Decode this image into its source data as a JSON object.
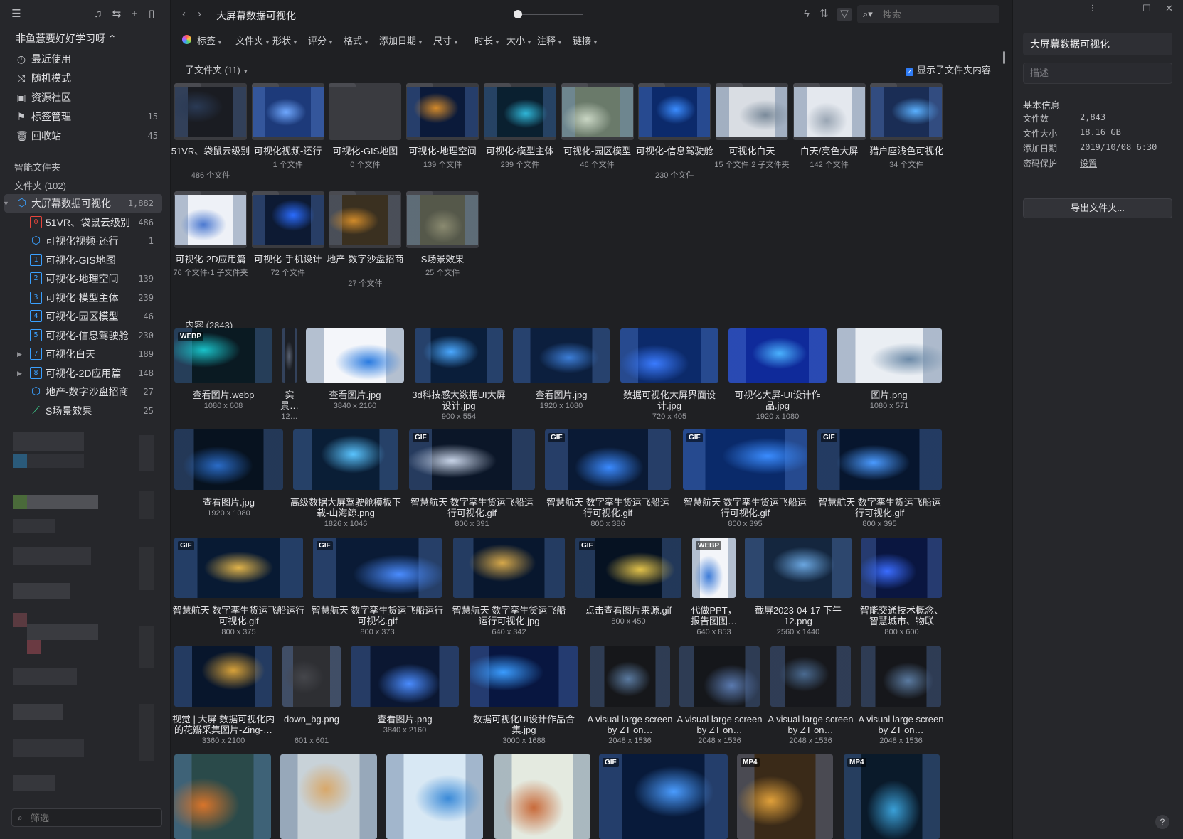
{
  "library": {
    "name": "非鱼薏要好好学习呀 ⌃"
  },
  "nav": [
    {
      "label": "最近使用",
      "icon": "clock-icon",
      "count": ""
    },
    {
      "label": "随机模式",
      "icon": "shuffle-icon",
      "count": ""
    },
    {
      "label": "资源社区",
      "icon": "community-icon",
      "count": ""
    },
    {
      "label": "标签管理",
      "icon": "bookmark-icon",
      "count": "15"
    },
    {
      "label": "回收站",
      "icon": "trash-icon",
      "count": "45"
    }
  ],
  "sections": {
    "smart": "智能文件夹",
    "folders": "文件夹 (102)"
  },
  "folder_tree": [
    {
      "label": "大屏幕数据可视化",
      "count": "1,882",
      "icon": "cube",
      "num": "",
      "color": "#3aa0ff",
      "level": 0,
      "caret": "▾",
      "selected": true
    },
    {
      "label": "51VR、袋鼠云级别",
      "count": "486",
      "icon": "num",
      "num": "0",
      "color": "#e8453c",
      "level": 1,
      "caret": "",
      "selected": false
    },
    {
      "label": "可视化视频-还行",
      "count": "1",
      "icon": "cube",
      "num": "",
      "color": "#3aa0ff",
      "level": 1,
      "caret": "",
      "selected": false
    },
    {
      "label": "可视化-GIS地图",
      "count": "",
      "icon": "num",
      "num": "1",
      "color": "#3aa0ff",
      "level": 1,
      "caret": "",
      "selected": false
    },
    {
      "label": "可视化-地理空间",
      "count": "139",
      "icon": "num",
      "num": "2",
      "color": "#3aa0ff",
      "level": 1,
      "caret": "",
      "selected": false
    },
    {
      "label": "可视化-模型主体",
      "count": "239",
      "icon": "num",
      "num": "3",
      "color": "#3aa0ff",
      "level": 1,
      "caret": "",
      "selected": false
    },
    {
      "label": "可视化-园区模型",
      "count": "46",
      "icon": "num",
      "num": "4",
      "color": "#3aa0ff",
      "level": 1,
      "caret": "",
      "selected": false
    },
    {
      "label": "可视化-信息驾驶舱",
      "count": "230",
      "icon": "num",
      "num": "5",
      "color": "#3aa0ff",
      "level": 1,
      "caret": "",
      "selected": false
    },
    {
      "label": "可视化白天",
      "count": "189",
      "icon": "num",
      "num": "7",
      "color": "#3aa0ff",
      "level": 1,
      "caret": "›",
      "selected": false
    },
    {
      "label": "可视化-2D应用篇",
      "count": "148",
      "icon": "num",
      "num": "8",
      "color": "#3aa0ff",
      "level": 1,
      "caret": "›",
      "selected": false
    },
    {
      "label": "地产-数字沙盘招商",
      "count": "27",
      "icon": "cube",
      "num": "",
      "color": "#3aa0ff",
      "level": 1,
      "caret": "",
      "selected": false
    },
    {
      "label": "S场景效果",
      "count": "25",
      "icon": "leaf",
      "num": "",
      "color": "#3ecf8e",
      "level": 1,
      "caret": "",
      "selected": false
    }
  ],
  "sidebar_filter": {
    "placeholder": "筛选"
  },
  "topbar": {
    "title": "大屏幕数据可视化",
    "search_placeholder": "搜索"
  },
  "filters": [
    "标签",
    "文件夹",
    "形状",
    "评分",
    "格式",
    "添加日期",
    "尺寸",
    "时长",
    "大小",
    "注释",
    "链接"
  ],
  "subfolders": {
    "header": "子文件夹 (11)",
    "show_sub_content": "显示子文件夹内容",
    "items": [
      {
        "name": "51VR、袋鼠云级别",
        "meta": "486 个文件",
        "bg": "#1a1c22",
        "accent": "#2a3a55"
      },
      {
        "name": "可视化视频-还行",
        "meta": "1 个文件",
        "bg": "#1d3a7a",
        "accent": "#6fa8ff"
      },
      {
        "name": "可视化-GIS地图",
        "meta": "0 个文件",
        "bg": "#3a3b40",
        "accent": "#3a3b40"
      },
      {
        "name": "可视化-地理空间",
        "meta": "139 个文件",
        "bg": "#0b1a3a",
        "accent": "#d48a2a"
      },
      {
        "name": "可视化-模型主体",
        "meta": "239 个文件",
        "bg": "#0a2030",
        "accent": "#2fb6d8"
      },
      {
        "name": "可视化-园区模型",
        "meta": "46 个文件",
        "bg": "#6a7a6a",
        "accent": "#c9d6c4"
      },
      {
        "name": "可视化-信息驾驶舱",
        "meta": "230 个文件",
        "bg": "#0c2a6b",
        "accent": "#3a8cff"
      },
      {
        "name": "可视化白天",
        "meta": "15 个文件·2 子文件夹",
        "bg": "#d9dde3",
        "accent": "#7a8a9a"
      },
      {
        "name": "白天/亮色大屏",
        "meta": "142 个文件",
        "bg": "#e4e8ee",
        "accent": "#9aa6b4"
      },
      {
        "name": "猎户座浅色可视化",
        "meta": "34 个文件",
        "bg": "#1a2d55",
        "accent": "#5ab0ff"
      },
      {
        "name": "可视化-2D应用篇",
        "meta": "76 个文件·1 子文件夹",
        "bg": "#eef1f7",
        "accent": "#4a78d0"
      },
      {
        "name": "可视化-手机设计",
        "meta": "72 个文件",
        "bg": "#0d1a33",
        "accent": "#2a6cff"
      },
      {
        "name": "地产-数字沙盘招商",
        "meta": "27 个文件",
        "bg": "#3a3020",
        "accent": "#d08a2a"
      },
      {
        "name": "S场景效果",
        "meta": "25 个文件",
        "bg": "#55584a",
        "accent": "#8a8a70"
      }
    ]
  },
  "content": {
    "header": "内容 (2843)",
    "rows": [
      [
        {
          "name": "查看图片.webp",
          "dim": "1080 x 608",
          "badge": "WEBP",
          "bg": "#0a1a22",
          "accent": "#19c2c9"
        },
        {
          "name": "实景…",
          "dim": "12…",
          "badge": "",
          "bg": "#1c1f25",
          "accent": "#5a6272"
        },
        {
          "name": "查看图片.jpg",
          "dim": "3840 x 2160",
          "badge": "",
          "bg": "#f4f6fa",
          "accent": "#2a7be0"
        },
        {
          "name": "3d科技感大数据UI大屏设计.jpg",
          "dim": "900 x 554",
          "badge": "",
          "bg": "#0a1e3a",
          "accent": "#4aa8ff"
        },
        {
          "name": "查看图片.jpg",
          "dim": "1920 x 1080",
          "badge": "",
          "bg": "#0c1f3e",
          "accent": "#3c7ed8"
        },
        {
          "name": "数据可视化大屏界面设计.jpg",
          "dim": "720 x 405",
          "badge": "",
          "bg": "#0c2a6a",
          "accent": "#3a7bff"
        },
        {
          "name": "可视化大屏-UI设计作品.jpg",
          "dim": "1920 x 1080",
          "badge": "",
          "bg": "#0f2a9a",
          "accent": "#4ab2ff"
        },
        {
          "name": "图片.png",
          "dim": "1080 x 571",
          "badge": "",
          "bg": "#eaeef3",
          "accent": "#6c8aa8"
        }
      ],
      [
        {
          "name": "查看图片.jpg",
          "dim": "1920 x 1080",
          "badge": "",
          "bg": "#07121f",
          "accent": "#2a6cc8"
        },
        {
          "name": "高级数据大屏驾驶舱模板下载-山海鲸.png",
          "dim": "1826 x 1046",
          "badge": "",
          "bg": "#0a1e36",
          "accent": "#5ac4ff"
        },
        {
          "name": "智慧航天 数字孪生货运飞船运行可视化.gif",
          "dim": "800 x 391",
          "badge": "GIF",
          "bg": "#0b1628",
          "accent": "#c8d4e8"
        },
        {
          "name": "智慧航天 数字孪生货运飞船运行可视化.gif",
          "dim": "800 x 386",
          "badge": "GIF",
          "bg": "#0a1a35",
          "accent": "#3a8aff"
        },
        {
          "name": "智慧航天 数字孪生货运飞船运行可视化.gif",
          "dim": "800 x 395",
          "badge": "GIF",
          "bg": "#0a2a6a",
          "accent": "#3a8cff"
        },
        {
          "name": "智慧航天 数字孪生货运飞船运行可视化.gif",
          "dim": "800 x 395",
          "badge": "GIF",
          "bg": "#07162e",
          "accent": "#4a9aff"
        }
      ],
      [
        {
          "name": "智慧航天 数字孪生货运飞船运行可视化.gif",
          "dim": "800 x 375",
          "badge": "GIF",
          "bg": "#081a33",
          "accent": "#e0b34a"
        },
        {
          "name": "智慧航天 数字孪生货运飞船运行可视化.gif",
          "dim": "800 x 373",
          "badge": "GIF",
          "bg": "#0a1b36",
          "accent": "#4a8cff"
        },
        {
          "name": "智慧航天 数字孪生货运飞船运行可视化.jpg",
          "dim": "640 x 342",
          "badge": "",
          "bg": "#08172e",
          "accent": "#d6a84a"
        },
        {
          "name": "点击查看图片来源.gif",
          "dim": "800 x 450",
          "badge": "GIF",
          "bg": "#061222",
          "accent": "#e2c24a"
        },
        {
          "name": "代做PPT，报告图图…",
          "dim": "640 x 853",
          "badge": "WEBP",
          "bg": "#f3f5f9",
          "accent": "#3c7bd8"
        },
        {
          "name": "截屏2023-04-17 下午12.png",
          "dim": "2560 x 1440",
          "badge": "",
          "bg": "#14263e",
          "accent": "#6aa6e0"
        },
        {
          "name": "智能交通技术概念、智慧城市、物联网、…",
          "dim": "800 x 600",
          "badge": "",
          "bg": "#0a1640",
          "accent": "#3a6cff"
        }
      ],
      [
        {
          "name": "视觉 | 大屏 数据可视化内的花瓣采集图片-Zing-…",
          "dim": "3360 x 2100",
          "badge": "",
          "bg": "#08162c",
          "accent": "#d8a23a"
        },
        {
          "name": "down_bg.png",
          "dim": "601 x 601",
          "badge": "",
          "bg": "#2e2f33",
          "accent": "#45464b"
        },
        {
          "name": "查看图片.png",
          "dim": "3840 x 2160",
          "badge": "",
          "bg": "#0b1732",
          "accent": "#4a8cff"
        },
        {
          "name": "数据可视化UI设计作品合集.jpg",
          "dim": "3000 x 1688",
          "badge": "",
          "bg": "#081640",
          "accent": "#3a9cff"
        },
        {
          "name": "A visual large screen by ZT on…",
          "dim": "2048 x 1536",
          "badge": "",
          "bg": "#16171a",
          "accent": "#5a7aa0"
        },
        {
          "name": "A visual large screen by ZT on…",
          "dim": "2048 x 1536",
          "badge": "",
          "bg": "#15171b",
          "accent": "#5a7ab0"
        },
        {
          "name": "A visual large screen by ZT on…",
          "dim": "2048 x 1536",
          "badge": "",
          "bg": "#17181c",
          "accent": "#4a6a90"
        },
        {
          "name": "A visual large screen by ZT on…",
          "dim": "2048 x 1536",
          "badge": "",
          "bg": "#16171b",
          "accent": "#5a7aa0"
        }
      ],
      [
        {
          "name": "",
          "dim": "",
          "badge": "",
          "bg": "#2a4a4a",
          "accent": "#d8742a"
        },
        {
          "name": "",
          "dim": "",
          "badge": "",
          "bg": "#c8d2d8",
          "accent": "#d8a86a"
        },
        {
          "name": "",
          "dim": "",
          "badge": "",
          "bg": "#d8e8f4",
          "accent": "#3a8ad8"
        },
        {
          "name": "",
          "dim": "",
          "badge": "",
          "bg": "#e4eae0",
          "accent": "#c86a3a"
        },
        {
          "name": "",
          "dim": "",
          "badge": "GIF",
          "bg": "#081a3a",
          "accent": "#4a9cff"
        },
        {
          "name": "",
          "dim": "",
          "badge": "MP4",
          "bg": "#3a2a18",
          "accent": "#e0a03a"
        },
        {
          "name": "",
          "dim": "",
          "badge": "MP4",
          "bg": "#0a1a2a",
          "accent": "#3aa0d8"
        }
      ]
    ]
  },
  "inspector": {
    "title": "大屏幕数据可视化",
    "desc_placeholder": "描述",
    "section": "基本信息",
    "fields": [
      {
        "k": "文件数",
        "v": "2,843"
      },
      {
        "k": "文件大小",
        "v": "18.16 GB"
      },
      {
        "k": "添加日期",
        "v": "2019/10/08 6:30"
      },
      {
        "k": "密码保护",
        "v": "设置"
      }
    ],
    "export": "导出文件夹...",
    "help": "?"
  },
  "colors": {
    "selected": "#3b3c42",
    "accent_blue": "#2f7cf6",
    "bg_main": "#1f2023",
    "bg_panel": "#26272b"
  }
}
